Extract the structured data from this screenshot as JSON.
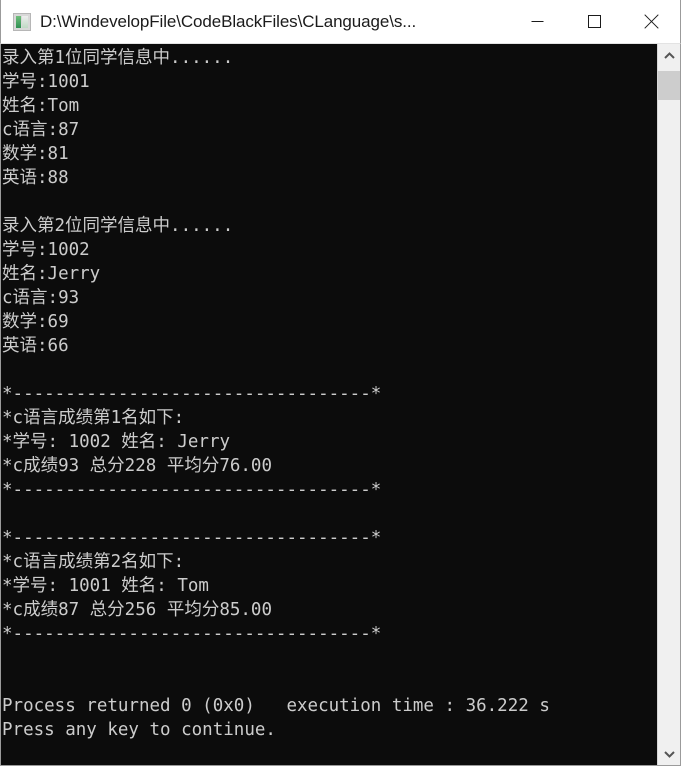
{
  "window": {
    "title": "D:\\WindevelopFile\\CodeBlackFiles\\CLanguage\\s...",
    "app_icon_name": "console-app-icon",
    "background_color": "#0c0c0c",
    "text_color": "#cccccc",
    "titlebar_color": "#ffffff",
    "border_color": "#9b9b9b"
  },
  "caption_buttons": {
    "minimize_label": "Minimize",
    "maximize_label": "Maximize",
    "close_label": "Close"
  },
  "console": {
    "lines": [
      "录入第1位同学信息中......",
      "学号:1001",
      "姓名:Tom",
      "c语言:87",
      "数学:81",
      "英语:88",
      "",
      "录入第2位同学信息中......",
      "学号:1002",
      "姓名:Jerry",
      "c语言:93",
      "数学:69",
      "英语:66",
      "",
      "*----------------------------------*",
      "*c语言成绩第1名如下:",
      "*学号: 1002 姓名: Jerry",
      "*c成绩93 总分228 平均分76.00",
      "*----------------------------------*",
      "",
      "*----------------------------------*",
      "*c语言成绩第2名如下:",
      "*学号: 1001 姓名: Tom",
      "*c成绩87 总分256 平均分85.00",
      "*----------------------------------*",
      "",
      "",
      "Process returned 0 (0x0)   execution time : 36.222 s",
      "Press any key to continue."
    ],
    "students": [
      {
        "index": 1,
        "prompt": "录入第1位同学信息中......",
        "id_label": "学号",
        "id": "1001",
        "name_label": "姓名",
        "name": "Tom",
        "c_label": "c语言",
        "c_score": "87",
        "math_label": "数学",
        "math_score": "81",
        "english_label": "英语",
        "english_score": "88"
      },
      {
        "index": 2,
        "prompt": "录入第2位同学信息中......",
        "id_label": "学号",
        "id": "1002",
        "name_label": "姓名",
        "name": "Jerry",
        "c_label": "c语言",
        "c_score": "93",
        "math_label": "数学",
        "math_score": "69",
        "english_label": "英语",
        "english_score": "66"
      }
    ],
    "rankings": [
      {
        "rank": 1,
        "heading": "*c语言成绩第1名如下:",
        "id_line": "*学号: 1002 姓名: Jerry",
        "score_line": "*c成绩93 总分228 平均分76.00",
        "id": "1002",
        "name": "Jerry",
        "c_score": "93",
        "total": "228",
        "average": "76.00"
      },
      {
        "rank": 2,
        "heading": "*c语言成绩第2名如下:",
        "id_line": "*学号: 1001 姓名: Tom",
        "score_line": "*c成绩87 总分256 平均分85.00",
        "id": "1001",
        "name": "Tom",
        "c_score": "87",
        "total": "256",
        "average": "85.00"
      }
    ],
    "separator": "*----------------------------------*",
    "exit_status": "Process returned 0 (0x0)   execution time : 36.222 s",
    "return_code": "0",
    "return_code_hex": "(0x0)",
    "execution_time": "36.222 s",
    "prompt": "Press any key to continue."
  },
  "scrollbar": {
    "up_arrow_name": "scroll-up",
    "down_arrow_name": "scroll-down",
    "thumb_color": "#cdcdcd",
    "track_color": "#f0f0f0"
  }
}
